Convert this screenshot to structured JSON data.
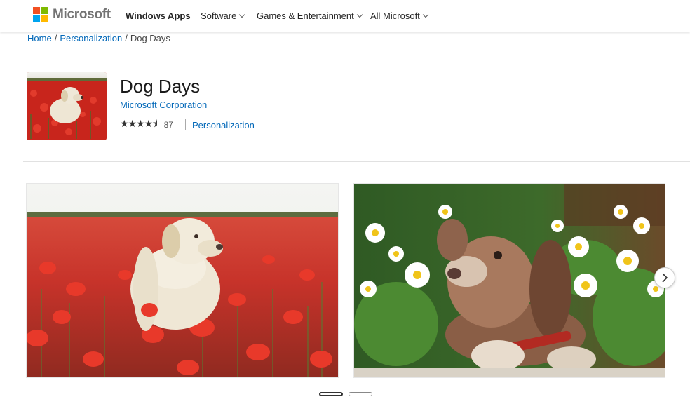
{
  "header": {
    "brand": "Microsoft",
    "nav": [
      {
        "label": "Windows Apps",
        "dropdown": false
      },
      {
        "label": "Software",
        "dropdown": true
      },
      {
        "label": "Games & Entertainment",
        "dropdown": true
      },
      {
        "label": "All Microsoft",
        "dropdown": true
      }
    ]
  },
  "breadcrumb": {
    "home": "Home",
    "category": "Personalization",
    "current": "Dog Days",
    "separator": "/"
  },
  "app": {
    "title": "Dog Days",
    "publisher": "Microsoft Corporation",
    "rating_stars": "★★★★⯨",
    "rating_value": 4.5,
    "rating_count": "87",
    "category": "Personalization"
  },
  "carousel": {
    "slides": 2,
    "active_index": 0
  },
  "colors": {
    "link": "#0067b8",
    "ms_red": "#f25022",
    "ms_green": "#7fba00",
    "ms_blue": "#00a4ef",
    "ms_yellow": "#ffb900"
  }
}
